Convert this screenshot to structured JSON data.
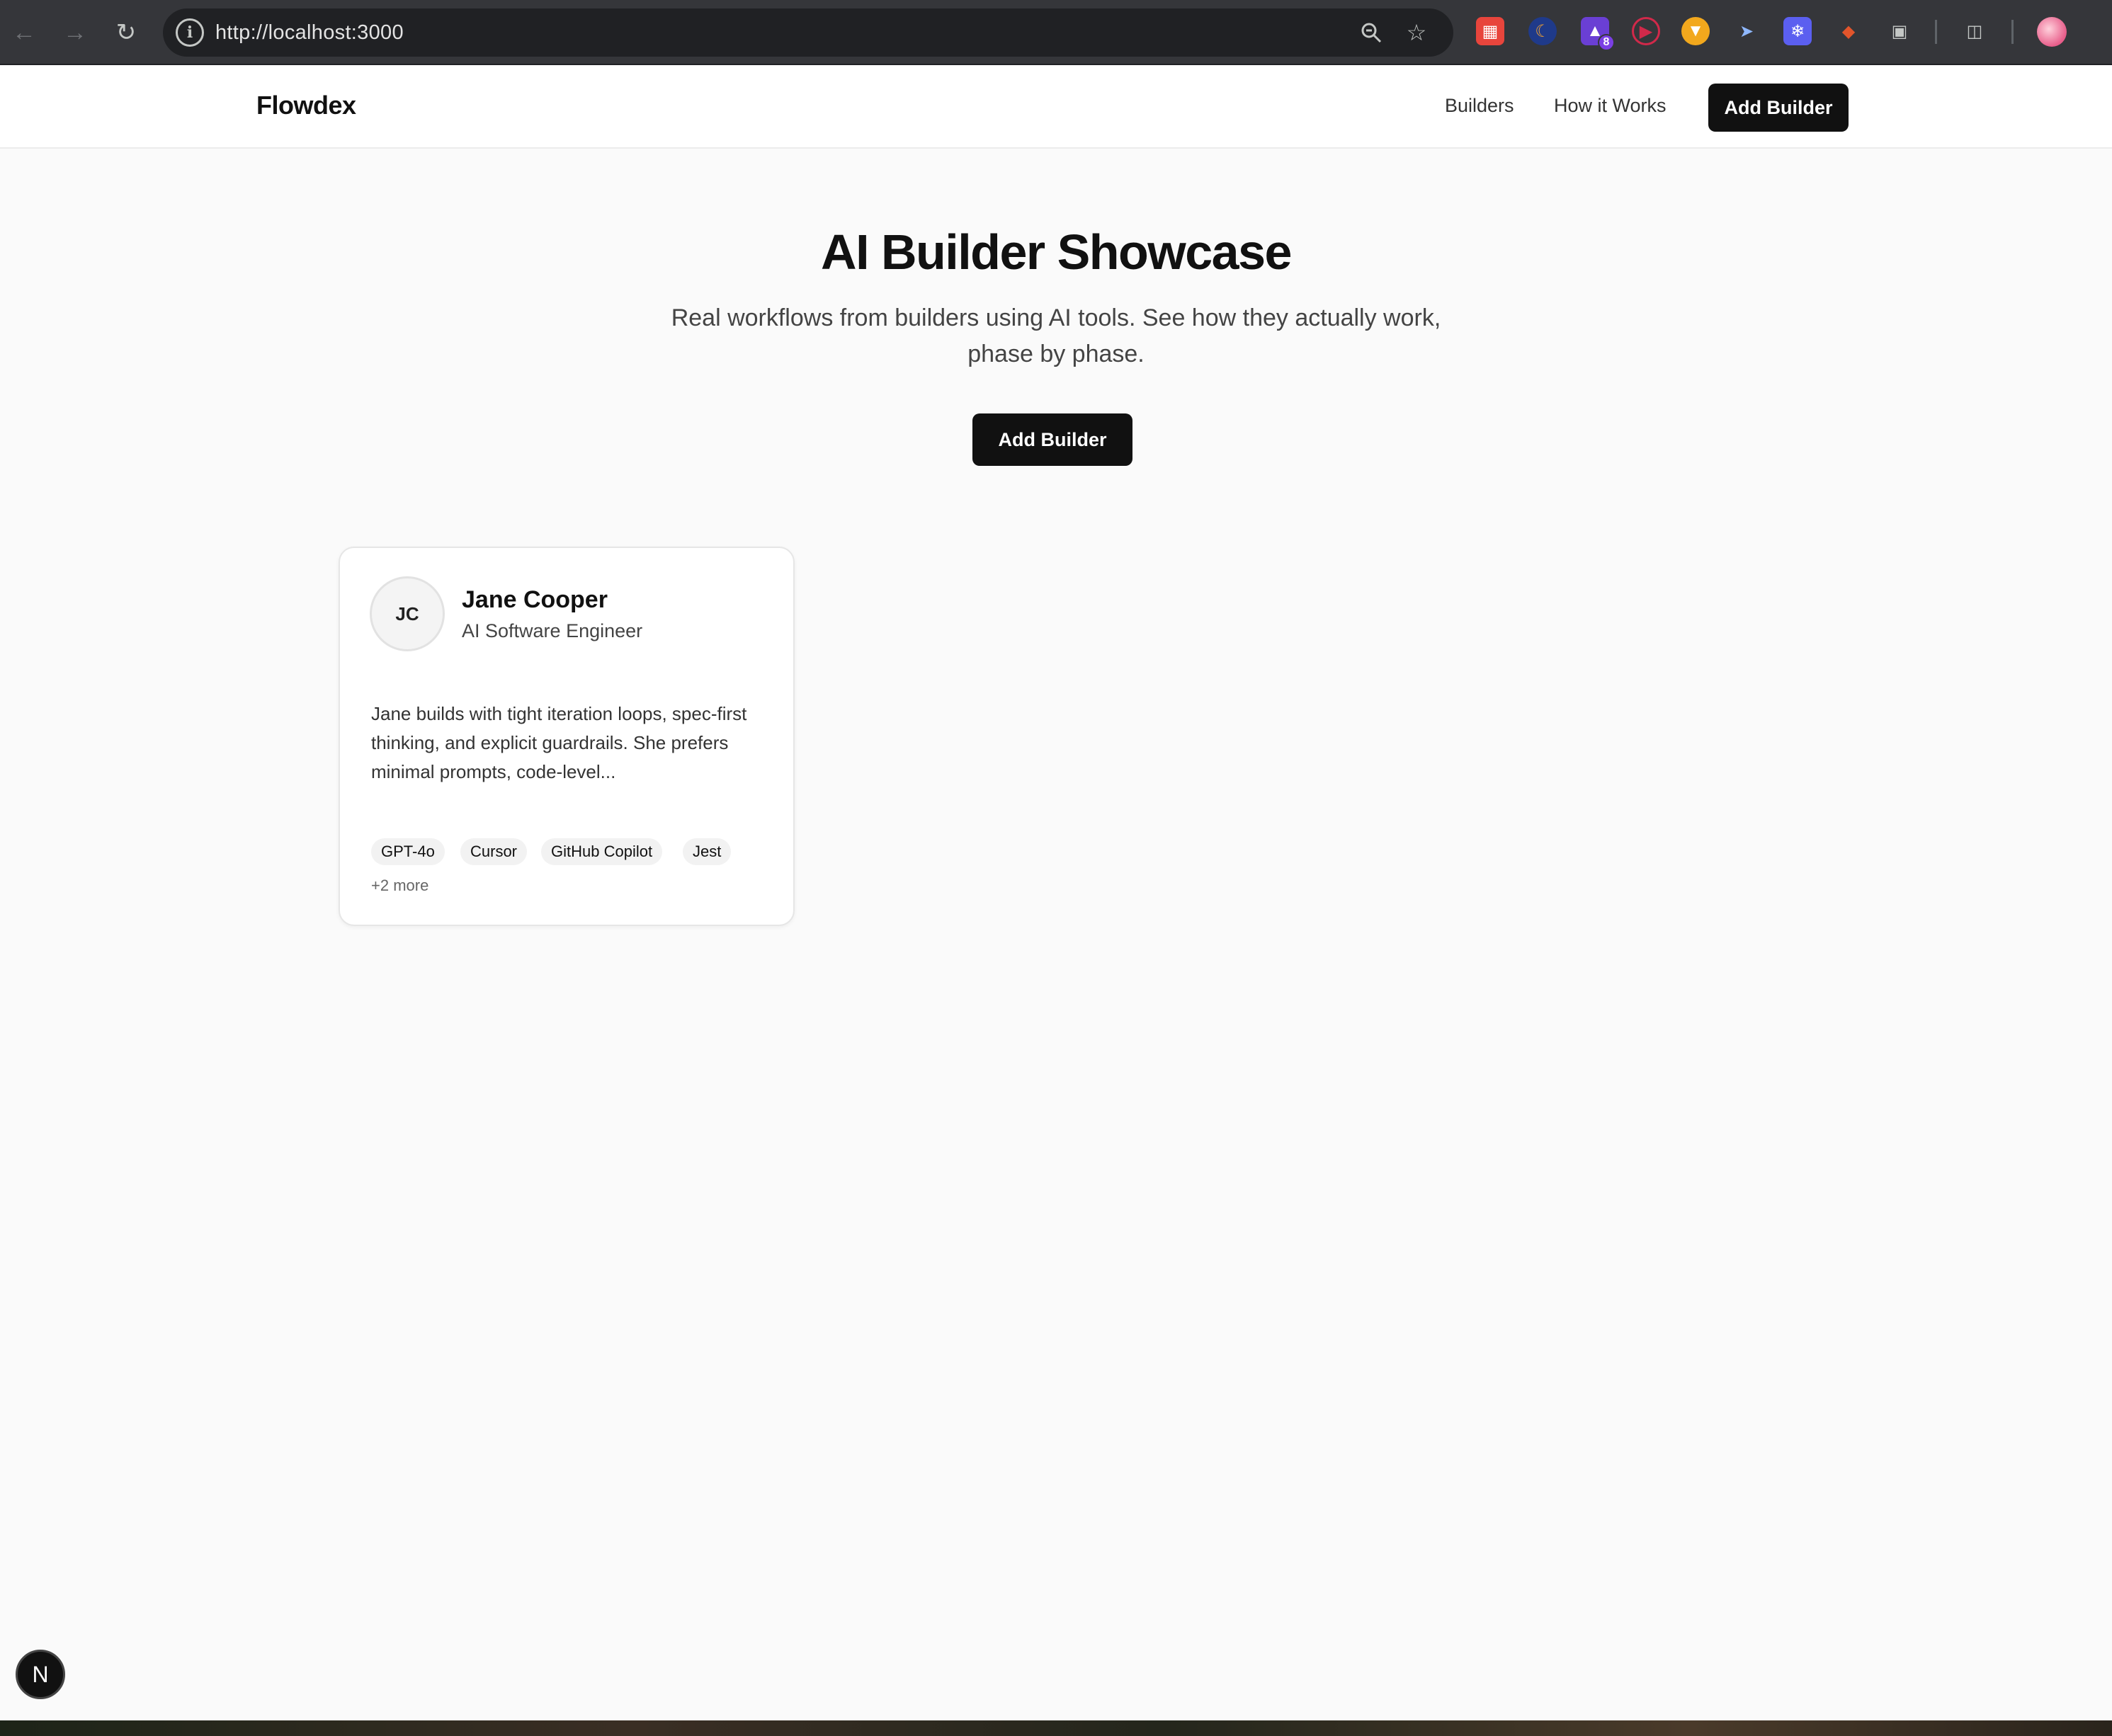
{
  "browser": {
    "url": "http://localhost:3000",
    "extensions": [
      {
        "name": "ext-red-icon",
        "color": "#e8453c"
      },
      {
        "name": "ext-moon-icon",
        "color": "#f0a030"
      },
      {
        "name": "ext-purple-icon",
        "color": "#6a3fd4",
        "badge": "8"
      },
      {
        "name": "ext-play-icon",
        "color": "#d1294a"
      },
      {
        "name": "ext-orange-icon",
        "color": "#f2a81d"
      },
      {
        "name": "ext-rocket-icon",
        "color": "#4a8ef2"
      },
      {
        "name": "ext-snowflake-icon",
        "color": "#5b5ff0"
      },
      {
        "name": "ext-fox-icon",
        "color": "#e2552b"
      }
    ]
  },
  "site": {
    "logo": "Flowdex",
    "nav": {
      "builders": "Builders",
      "how_it_works": "How it Works",
      "add_builder": "Add Builder"
    }
  },
  "hero": {
    "title": "AI Builder Showcase",
    "subtitle": "Real workflows from builders using AI tools. See how they actually work, phase by phase.",
    "cta": "Add Builder"
  },
  "builders": [
    {
      "initials": "JC",
      "name": "Jane Cooper",
      "role": "AI Software Engineer",
      "bio": "Jane builds with tight iteration loops, spec-first thinking, and explicit guardrails. She prefers minimal prompts, code-level...",
      "tags": [
        "GPT-4o",
        "Cursor",
        "GitHub Copilot",
        "Jest"
      ],
      "more": "+2 more"
    }
  ],
  "dev_badge": "N"
}
